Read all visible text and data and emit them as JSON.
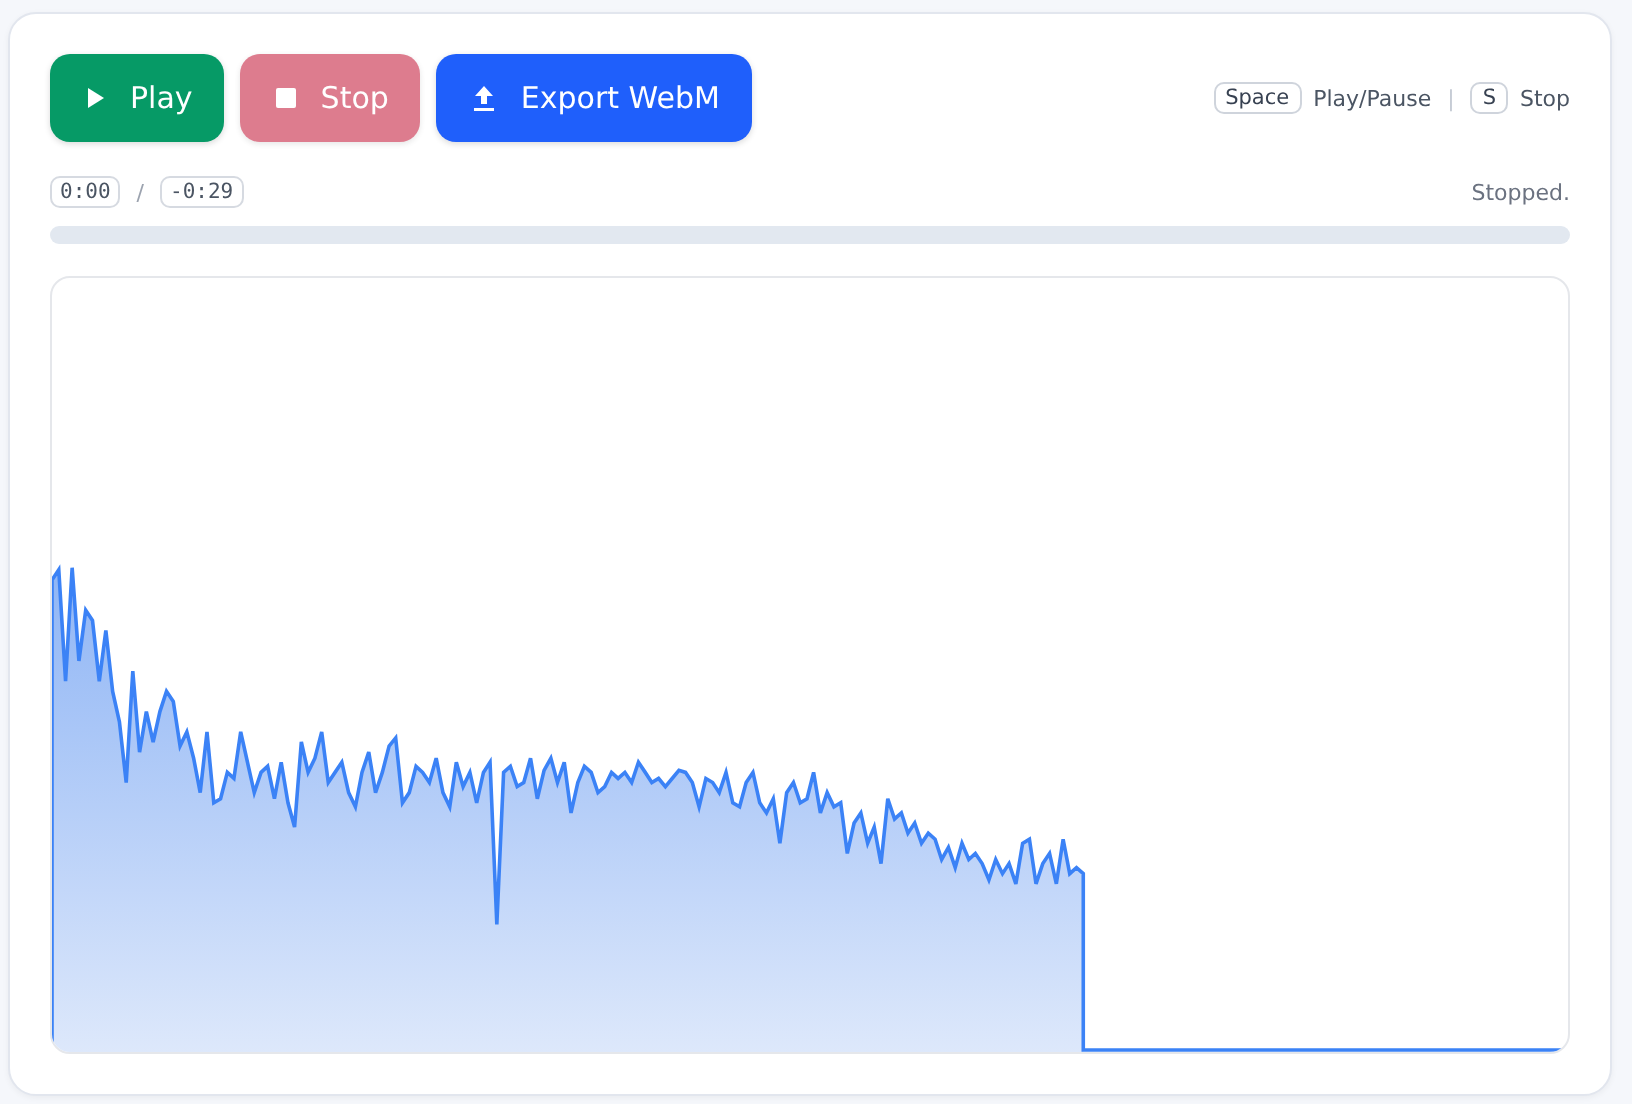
{
  "buttons": [
    {
      "kind": "play",
      "label": "Play",
      "disabled": false
    },
    {
      "kind": "stop",
      "label": "Stop",
      "disabled": true
    },
    {
      "kind": "export",
      "label": "Export WebM",
      "disabled": false
    }
  ],
  "shortcut_separator": "|",
  "shortcuts": [
    {
      "key": "Space",
      "action": "Play/Pause"
    },
    {
      "key": "S",
      "action": "Stop"
    }
  ],
  "time": {
    "elapsed": "0:00",
    "separator": "/",
    "remaining": "-0:29"
  },
  "status": "Stopped.",
  "progress": {
    "level": 0
  }
}
